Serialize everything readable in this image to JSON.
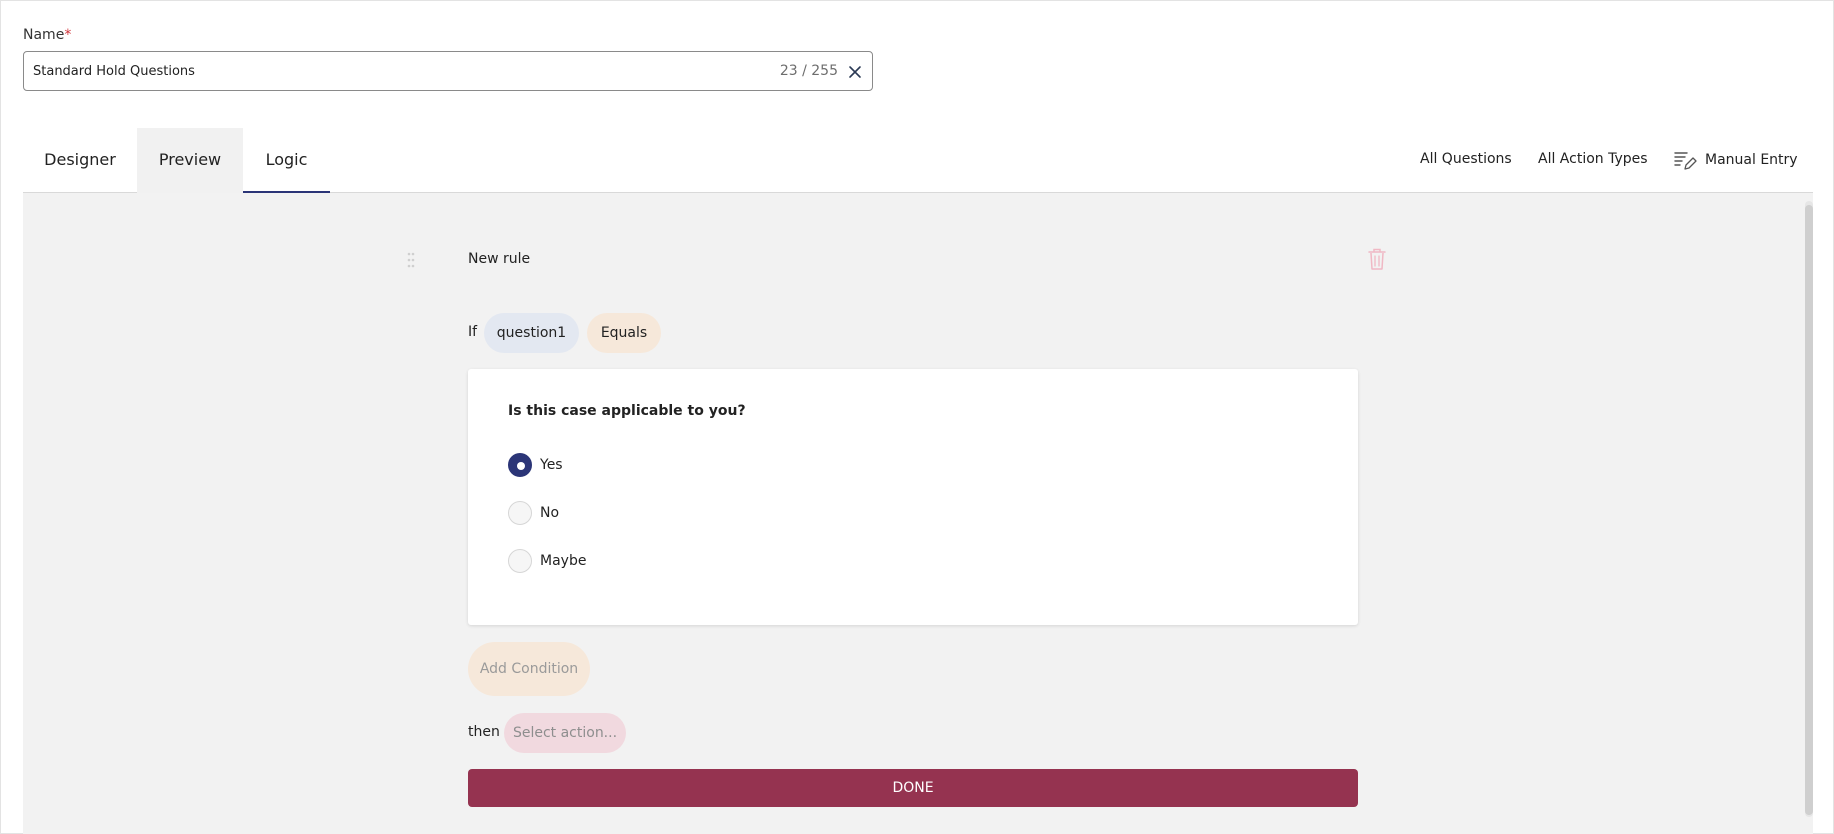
{
  "name_field": {
    "label": "Name",
    "required_mark": "*",
    "value": "Standard Hold Questions",
    "counter": "23 / 255"
  },
  "tabs": [
    {
      "label": "Designer"
    },
    {
      "label": "Preview"
    },
    {
      "label": "Logic"
    }
  ],
  "toolbar": {
    "all_questions": "All Questions",
    "all_action_types": "All Action Types",
    "manual_entry": "Manual Entry"
  },
  "rule": {
    "title": "New rule",
    "if_label": "If",
    "question_chip": "question1",
    "operator_chip": "Equals",
    "question": {
      "text": "Is this case applicable to you?",
      "options": [
        {
          "label": "Yes",
          "selected": true
        },
        {
          "label": "No",
          "selected": false
        },
        {
          "label": "Maybe",
          "selected": false
        }
      ]
    },
    "add_condition": "Add Condition",
    "then_label": "then",
    "select_action": "Select action...",
    "done": "DONE"
  },
  "colors": {
    "accent": "#2b3577",
    "done": "#953350",
    "chip_question": "#e3e8f1",
    "chip_operator": "#f6e8da",
    "chip_action": "#f1d9df",
    "panel": "#f2f2f2"
  }
}
